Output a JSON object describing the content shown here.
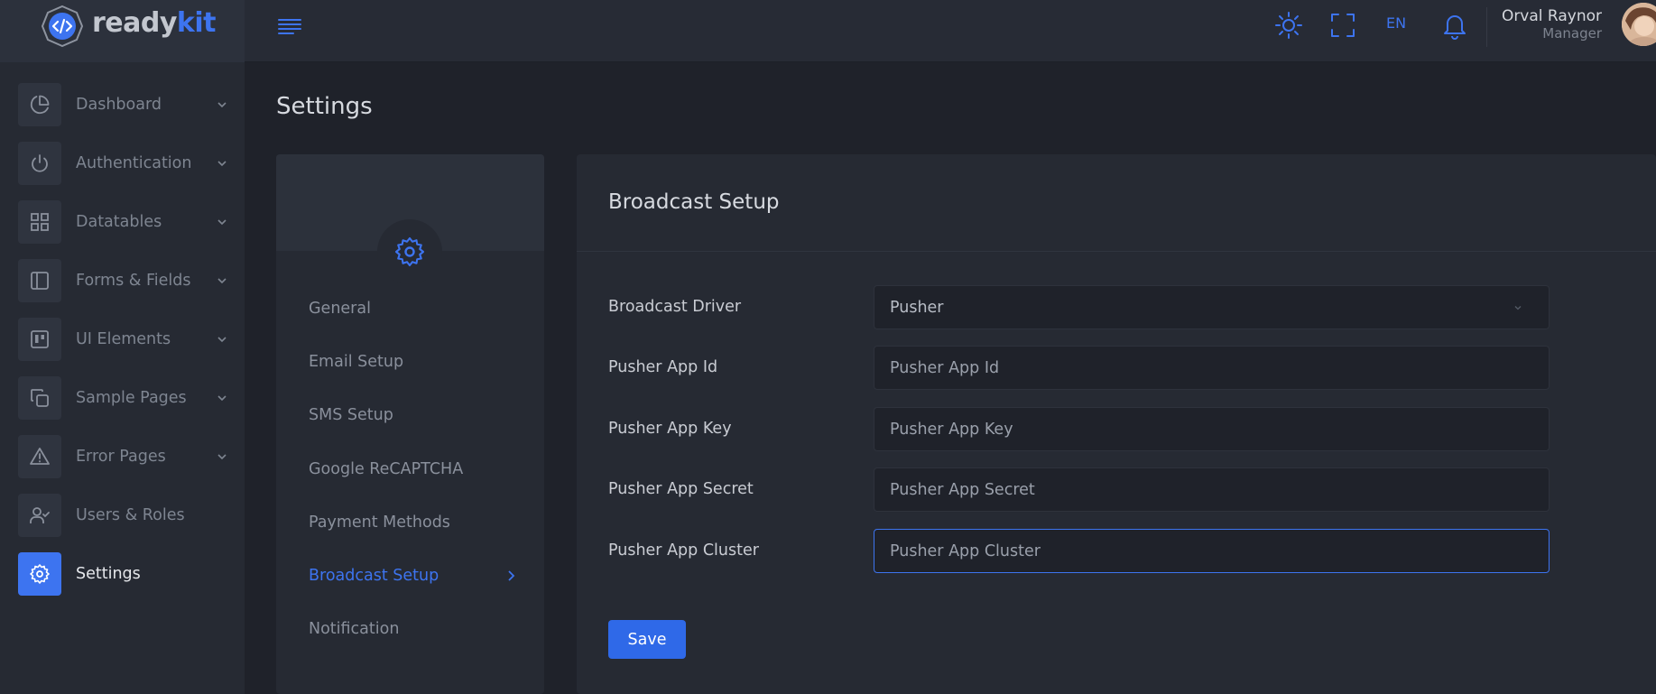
{
  "brand": {
    "name_part1": "ready",
    "name_part2": "kit"
  },
  "topbar": {
    "language": "EN",
    "user": {
      "name": "Orval Raynor",
      "role": "Manager"
    }
  },
  "sidebar": {
    "items": [
      {
        "label": "Dashboard",
        "icon": "pie-chart-icon"
      },
      {
        "label": "Authentication",
        "icon": "power-icon"
      },
      {
        "label": "Datatables",
        "icon": "grid-icon"
      },
      {
        "label": "Forms & Fields",
        "icon": "sidebar-layout-icon"
      },
      {
        "label": "UI Elements",
        "icon": "trello-icon"
      },
      {
        "label": "Sample Pages",
        "icon": "copy-icon"
      },
      {
        "label": "Error Pages",
        "icon": "alert-triangle-icon"
      },
      {
        "label": "Users & Roles",
        "icon": "user-check-icon"
      },
      {
        "label": "Settings",
        "icon": "gear-icon"
      }
    ]
  },
  "page": {
    "title": "Settings"
  },
  "settings_nav": {
    "items": [
      "General",
      "Email Setup",
      "SMS Setup",
      "Google ReCAPTCHA",
      "Payment Methods",
      "Broadcast Setup",
      "Notification"
    ],
    "active": "Broadcast Setup"
  },
  "form": {
    "title": "Broadcast Setup",
    "driver_label": "Broadcast Driver",
    "driver_value": "Pusher",
    "app_id_label": "Pusher App Id",
    "app_id_placeholder": "Pusher App Id",
    "app_key_label": "Pusher App Key",
    "app_key_placeholder": "Pusher App Key",
    "app_secret_label": "Pusher App Secret",
    "app_secret_placeholder": "Pusher App Secret",
    "app_cluster_label": "Pusher App Cluster",
    "app_cluster_placeholder": "Pusher App Cluster",
    "save_label": "Save"
  },
  "colors": {
    "accent": "#3d74f0",
    "background": "#1f222a",
    "panel": "#262a33"
  }
}
